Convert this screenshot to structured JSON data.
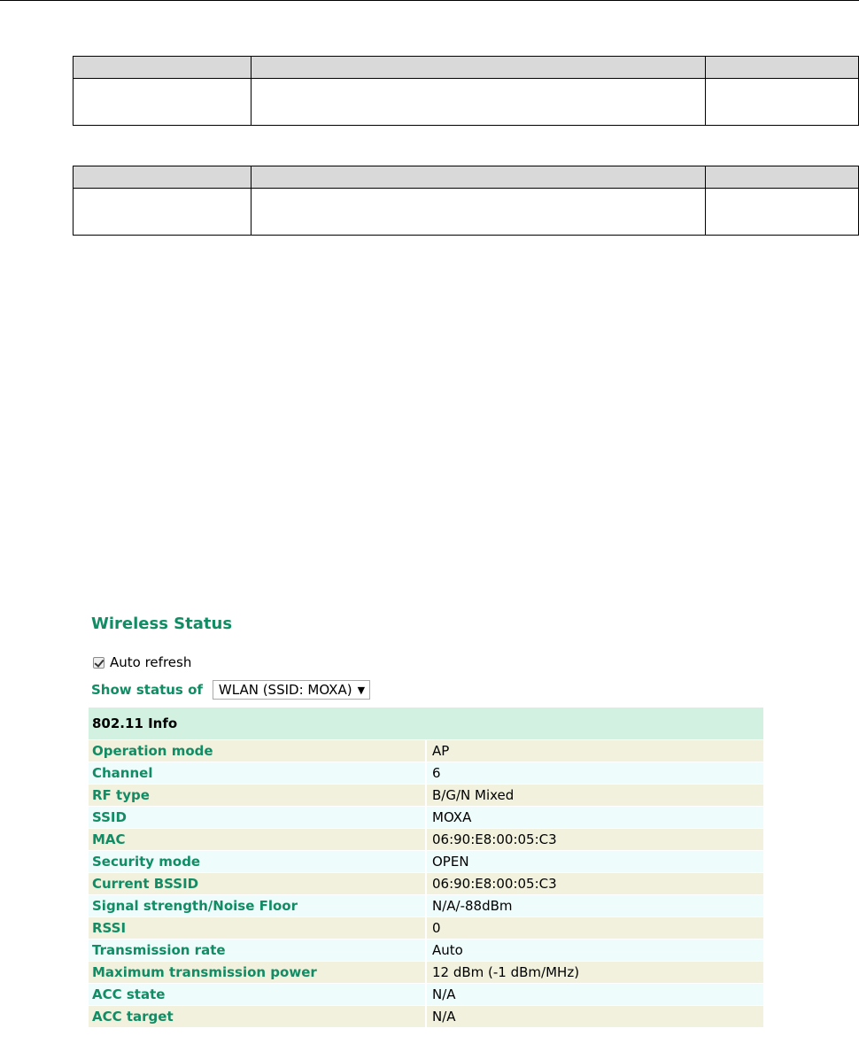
{
  "title": "Wireless Status",
  "auto_refresh": {
    "label": "Auto refresh",
    "checked": true
  },
  "show_status": {
    "label": "Show status of",
    "selected": "WLAN (SSID: MOXA)"
  },
  "info_section": {
    "header": "802.11 Info",
    "rows": [
      {
        "key": "Operation mode",
        "value": "AP"
      },
      {
        "key": "Channel",
        "value": "6"
      },
      {
        "key": "RF type",
        "value": "B/G/N Mixed"
      },
      {
        "key": "SSID",
        "value": "MOXA"
      },
      {
        "key": "MAC",
        "value": "06:90:E8:00:05:C3"
      },
      {
        "key": "Security mode",
        "value": "OPEN"
      },
      {
        "key": "Current BSSID",
        "value": "06:90:E8:00:05:C3"
      },
      {
        "key": "Signal strength/Noise Floor",
        "value": "N/A/-88dBm"
      },
      {
        "key": "RSSI",
        "value": "0"
      },
      {
        "key": "Transmission rate",
        "value": "Auto"
      },
      {
        "key": "Maximum transmission power",
        "value": "12 dBm (-1 dBm/MHz)"
      },
      {
        "key": "ACC state",
        "value": "N/A"
      },
      {
        "key": "ACC target",
        "value": "N/A"
      }
    ]
  },
  "colors": {
    "accent_green": "#118c64",
    "section_bg": "#d3f1e0",
    "row_odd_bg": "#f1f1dd",
    "row_even_bg": "#eefcfc",
    "doc_header_bg": "#d9d9d9"
  }
}
